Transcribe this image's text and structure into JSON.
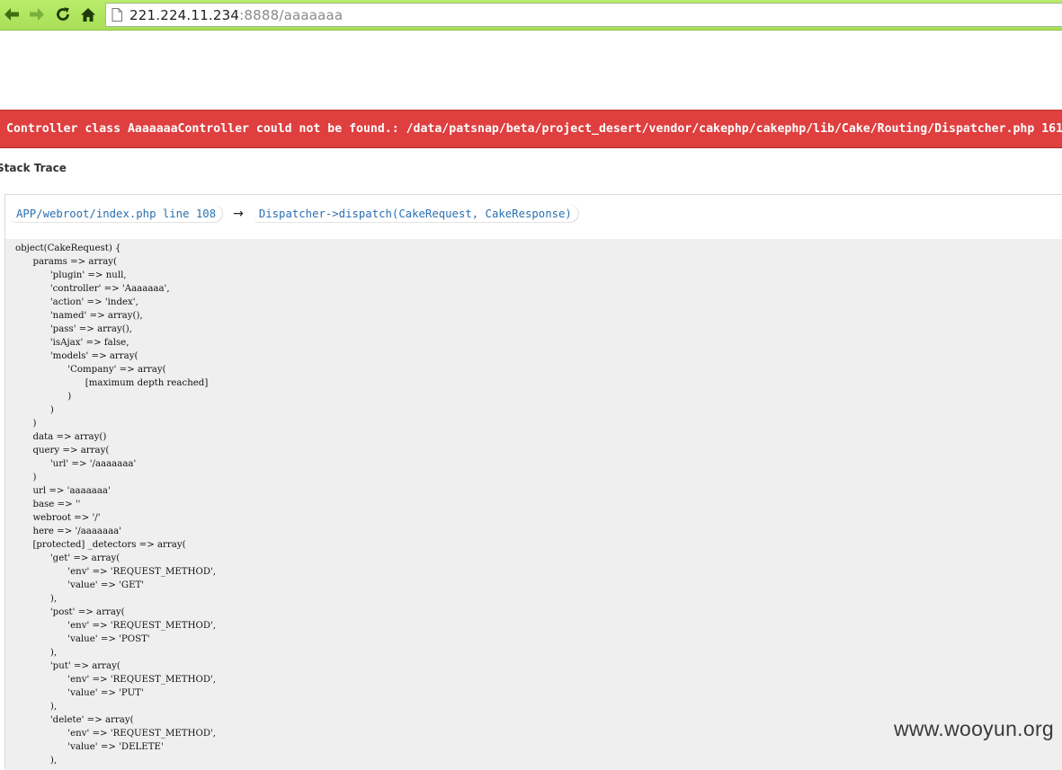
{
  "browser": {
    "icons": {
      "back": "back-arrow-icon",
      "forward": "forward-arrow-icon",
      "reload": "reload-icon",
      "home": "home-icon",
      "page": "page-icon"
    },
    "colors": {
      "toolbar": "#b9ec6a",
      "arrows": "#3f6e12"
    },
    "url": {
      "host": "221.224.11.234",
      "rest": ":8888/aaaaaaa"
    }
  },
  "error": {
    "message": "Controller class AaaaaaaController could not be found.: /data/patsnap/beta/project_desert/vendor/cakephp/cakephp/lib/Cake/Routing/Dispatcher.php 161",
    "color": "#df3f3f"
  },
  "stack": {
    "title": "Stack Trace",
    "frames": [
      "APP/webroot/index.php line 108",
      "Dispatcher->dispatch(CakeRequest, CakeResponse)"
    ],
    "arrow": "→",
    "dump_lines": [
      "object(CakeRequest) {",
      "\tparams => array(",
      "\t\t'plugin' => null,",
      "\t\t'controller' => 'Aaaaaaa',",
      "\t\t'action' => 'index',",
      "\t\t'named' => array(),",
      "\t\t'pass' => array(),",
      "\t\t'isAjax' => false,",
      "\t\t'models' => array(",
      "\t\t\t'Company' => array(",
      "\t\t\t\t[maximum depth reached]",
      "\t\t\t)",
      "\t\t)",
      "\t)",
      "\tdata => array()",
      "\tquery => array(",
      "\t\t'url' => '/aaaaaaa'",
      "\t)",
      "\turl => 'aaaaaaa'",
      "\tbase => ''",
      "\twebroot => '/'",
      "\there => '/aaaaaaa'",
      "\t[protected] _detectors => array(",
      "\t\t'get' => array(",
      "\t\t\t'env' => 'REQUEST_METHOD',",
      "\t\t\t'value' => 'GET'",
      "\t\t),",
      "\t\t'post' => array(",
      "\t\t\t'env' => 'REQUEST_METHOD',",
      "\t\t\t'value' => 'POST'",
      "\t\t),",
      "\t\t'put' => array(",
      "\t\t\t'env' => 'REQUEST_METHOD',",
      "\t\t\t'value' => 'PUT'",
      "\t\t),",
      "\t\t'delete' => array(",
      "\t\t\t'env' => 'REQUEST_METHOD',",
      "\t\t\t'value' => 'DELETE'",
      "\t\t),"
    ]
  },
  "watermark": "www.wooyun.org"
}
